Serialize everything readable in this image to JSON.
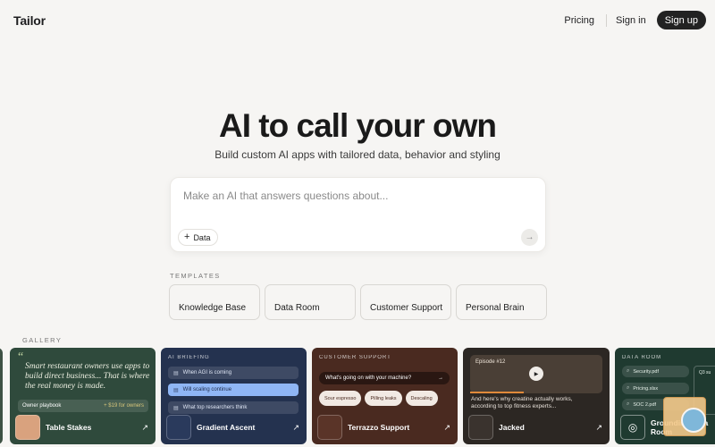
{
  "brand": "Tailor",
  "nav": {
    "pricing": "Pricing",
    "signin": "Sign in",
    "signup": "Sign up"
  },
  "hero": {
    "title": "AI to call your own",
    "subtitle": "Build custom AI apps with tailored data, behavior and styling"
  },
  "prompt": {
    "placeholder": "Make an AI that answers questions about...",
    "data_button": "Data",
    "send_icon": "arrow-right-icon"
  },
  "templates": {
    "label": "TEMPLATES",
    "items": [
      "Knowledge Base",
      "Data Room",
      "Customer Support",
      "Personal Brain"
    ]
  },
  "gallery": {
    "label": "GALLERY",
    "cards": [
      {
        "name": "Table Stakes",
        "quote": "Smart restaurant owners use apps to build direct business... That is where the real money is made.",
        "playbook": "Owner playbook",
        "price": "+ $19 for owners"
      },
      {
        "name": "Gradient Ascent",
        "tag": "AI BRIEFING",
        "rows": [
          "When AGI is coming",
          "Will scaling continue",
          "What top researchers think"
        ]
      },
      {
        "name": "Terrazzo Support",
        "tag": "CUSTOMER SUPPORT",
        "question": "What's going on with your machine?",
        "chips": [
          "Sour espresso",
          "Pilling leaks",
          "Descaling"
        ]
      },
      {
        "name": "Jacked",
        "episode": "Episode #12",
        "caption": "And here's why creatine actually works, according to top fitness experts..."
      },
      {
        "name": "Grounding Data Room",
        "tag": "DATA ROOM",
        "files": [
          "Security.pdf",
          "Pricing.xlsx",
          "SOC 2.pdf"
        ],
        "panel_text": "Q3 su"
      }
    ]
  },
  "colors": {
    "background": "#f6f5f3",
    "primary_button": "#222222",
    "table_stakes": "#2f4a3c",
    "gradient_ascent": "#24324f",
    "terrazzo": "#4a2a20",
    "jacked": "#2c2723",
    "data_room": "#1f3a30"
  }
}
